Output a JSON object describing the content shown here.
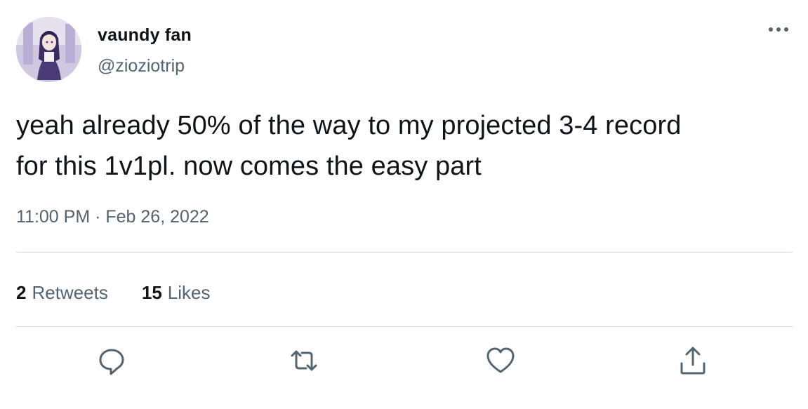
{
  "author": {
    "display_name": "vaundy fan",
    "handle": "@zioziotrip",
    "avatar_icon": "anime-character-avatar"
  },
  "more_icon": "more-horizontal-icon",
  "tweet": {
    "lines": [
      "yeah already 50% of the way to my projected 3-4 record",
      "for this 1v1pl. now comes the easy part"
    ],
    "timestamp": "11:00 PM · Feb 26, 2022"
  },
  "stats": {
    "retweets_count": "2",
    "retweets_label": "Retweets",
    "likes_count": "15",
    "likes_label": "Likes"
  },
  "actions": [
    {
      "name": "reply",
      "icon": "reply-icon"
    },
    {
      "name": "retweet",
      "icon": "retweet-icon"
    },
    {
      "name": "like",
      "icon": "heart-icon"
    },
    {
      "name": "share",
      "icon": "share-icon"
    }
  ],
  "colors": {
    "primary_text": "#0f1419",
    "secondary_text": "#536471",
    "divider": "#cfd9de",
    "icon": "#536471"
  }
}
